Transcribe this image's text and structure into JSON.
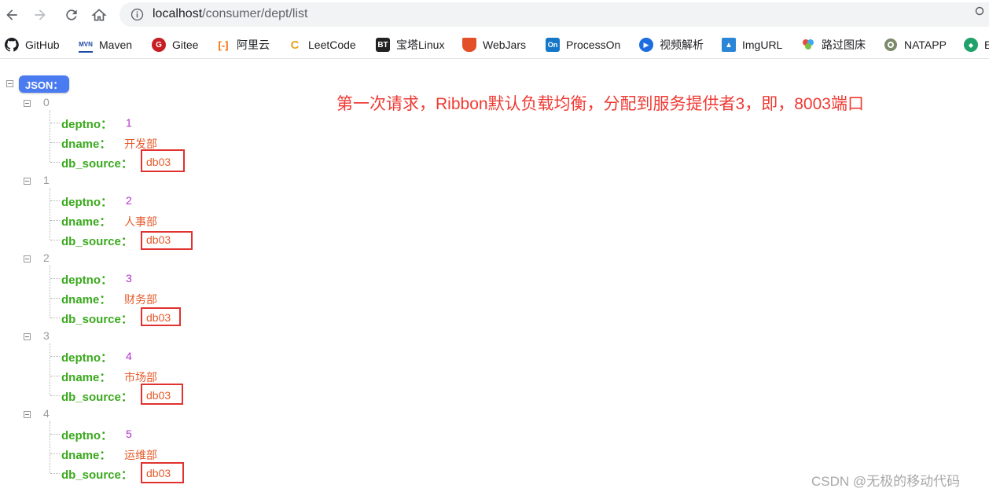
{
  "address_bar": {
    "host": "localhost",
    "path": "/consumer/dept/list"
  },
  "bookmarks": [
    {
      "label": "GitHub",
      "icon": "github-icon"
    },
    {
      "label": "Maven",
      "icon": "maven-icon"
    },
    {
      "label": "Gitee",
      "icon": "gitee-icon"
    },
    {
      "label": "阿里云",
      "icon": "aliyun-icon"
    },
    {
      "label": "LeetCode",
      "icon": "leetcode-icon"
    },
    {
      "label": "宝塔Linux",
      "icon": "bt-icon"
    },
    {
      "label": "WebJars",
      "icon": "webjars-icon"
    },
    {
      "label": "ProcessOn",
      "icon": "processon-icon"
    },
    {
      "label": "视频解析",
      "icon": "video-icon"
    },
    {
      "label": "ImgURL",
      "icon": "imgurl-icon"
    },
    {
      "label": "路过图床",
      "icon": "luguo-icon"
    },
    {
      "label": "NATAPP",
      "icon": "natapp-icon"
    },
    {
      "label": "E",
      "icon": "extra-icon"
    }
  ],
  "json_badge": "JSON：",
  "keys": {
    "deptno": "deptno：",
    "dname": "dname：",
    "db_source": "db_source："
  },
  "records": [
    {
      "index": "0",
      "deptno": "1",
      "dname": "开发部",
      "db_source": "db03"
    },
    {
      "index": "1",
      "deptno": "2",
      "dname": "人事部",
      "db_source": "db03"
    },
    {
      "index": "2",
      "deptno": "3",
      "dname": "财务部",
      "db_source": "db03"
    },
    {
      "index": "3",
      "deptno": "4",
      "dname": "市场部",
      "db_source": "db03"
    },
    {
      "index": "4",
      "deptno": "5",
      "dname": "运维部",
      "db_source": "db03"
    }
  ],
  "annotation": "第一次请求，Ribbon默认负载均衡，分配到服务提供者3，即，8003端口",
  "watermark": "CSDN @无极的移动代码",
  "colors": {
    "key": "#3aa91d",
    "number": "#b52cd0",
    "string": "#e55a2b",
    "highlight": "#e0322e",
    "badge": "#4a7bf0"
  }
}
